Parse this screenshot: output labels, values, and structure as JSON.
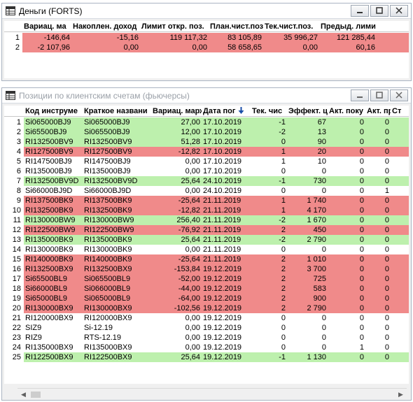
{
  "money_window": {
    "title": "Деньги (FORTS)",
    "columns": [
      "",
      "Вариац. ма",
      "Накоплен. доход",
      "Лимит откр. поз.",
      "План.чист.поз",
      "Тек.чист.поз.",
      "Предыд. лими"
    ],
    "rows": [
      {
        "n": "1",
        "cells": [
          "-146,64",
          "-15,16",
          "119 117,32",
          "83 105,89",
          "35 996,27",
          "121 285,44"
        ],
        "color": "red"
      },
      {
        "n": "2",
        "cells": [
          "-2 107,96",
          "0,00",
          "0,00",
          "58 658,65",
          "0,00",
          "60,16"
        ],
        "color": "red"
      }
    ]
  },
  "positions_window": {
    "title": "Позиции по клиентским счетам (фьючерсы)",
    "columns": [
      "",
      "Код инструме",
      "Краткое названи",
      "Вариац. марж",
      "Дата пог",
      "Тек. чис",
      "Эффект. ц",
      "Акт. поку",
      "Акт. пр",
      "Ст"
    ],
    "sort_icon": "sort-down-arrow",
    "rows": [
      {
        "n": "1",
        "code": "Si065000BJ9",
        "name": "Si065000BJ9",
        "var": "27,00",
        "date": "17.10.2019",
        "cur": "-1",
        "eff": "67",
        "buy": "0",
        "sell": "0",
        "color": "green"
      },
      {
        "n": "2",
        "code": "Si65500BJ9",
        "name": "Si065500BJ9",
        "var": "12,00",
        "date": "17.10.2019",
        "cur": "-2",
        "eff": "13",
        "buy": "0",
        "sell": "0",
        "color": "green"
      },
      {
        "n": "3",
        "code": "RI132500BV9",
        "name": "RI132500BV9",
        "var": "51,28",
        "date": "17.10.2019",
        "cur": "0",
        "eff": "90",
        "buy": "0",
        "sell": "0",
        "color": "green"
      },
      {
        "n": "4",
        "code": "RI127500BV9",
        "name": "RI127500BV9",
        "var": "-12,82",
        "date": "17.10.2019",
        "cur": "1",
        "eff": "20",
        "buy": "0",
        "sell": "0",
        "color": "red"
      },
      {
        "n": "5",
        "code": "RI147500BJ9",
        "name": "RI147500BJ9",
        "var": "0,00",
        "date": "17.10.2019",
        "cur": "1",
        "eff": "10",
        "buy": "0",
        "sell": "0",
        "color": "white"
      },
      {
        "n": "6",
        "code": "RI135000BJ9",
        "name": "RI135000BJ9",
        "var": "0,00",
        "date": "17.10.2019",
        "cur": "0",
        "eff": "0",
        "buy": "0",
        "sell": "0",
        "color": "white"
      },
      {
        "n": "7",
        "code": "RI132500BV9D",
        "name": "RI132500BV9D",
        "var": "25,64",
        "date": "24.10.2019",
        "cur": "-1",
        "eff": "730",
        "buy": "0",
        "sell": "0",
        "color": "green"
      },
      {
        "n": "8",
        "code": "Si66000BJ9D",
        "name": "Si66000BJ9D",
        "var": "0,00",
        "date": "24.10.2019",
        "cur": "0",
        "eff": "0",
        "buy": "0",
        "sell": "1",
        "color": "white"
      },
      {
        "n": "9",
        "code": "RI137500BK9",
        "name": "RI137500BK9",
        "var": "-25,64",
        "date": "21.11.2019",
        "cur": "1",
        "eff": "1 740",
        "buy": "0",
        "sell": "0",
        "color": "red"
      },
      {
        "n": "10",
        "code": "RI132500BK9",
        "name": "RI132500BK9",
        "var": "-12,82",
        "date": "21.11.2019",
        "cur": "1",
        "eff": "4 170",
        "buy": "0",
        "sell": "0",
        "color": "red"
      },
      {
        "n": "11",
        "code": "RI130000BW9",
        "name": "RI130000BW9",
        "var": "256,40",
        "date": "21.11.2019",
        "cur": "-2",
        "eff": "1 670",
        "buy": "0",
        "sell": "0",
        "color": "green"
      },
      {
        "n": "12",
        "code": "RI122500BW9",
        "name": "RI122500BW9",
        "var": "-76,92",
        "date": "21.11.2019",
        "cur": "2",
        "eff": "450",
        "buy": "0",
        "sell": "0",
        "color": "red"
      },
      {
        "n": "13",
        "code": "RI135000BK9",
        "name": "RI135000BK9",
        "var": "25,64",
        "date": "21.11.2019",
        "cur": "-2",
        "eff": "2 790",
        "buy": "0",
        "sell": "0",
        "color": "green"
      },
      {
        "n": "14",
        "code": "RI130000BK9",
        "name": "RI130000BK9",
        "var": "0,00",
        "date": "21.11.2019",
        "cur": "0",
        "eff": "0",
        "buy": "0",
        "sell": "0",
        "color": "white"
      },
      {
        "n": "15",
        "code": "RI140000BK9",
        "name": "RI140000BK9",
        "var": "-25,64",
        "date": "21.11.2019",
        "cur": "2",
        "eff": "1 010",
        "buy": "0",
        "sell": "0",
        "color": "red"
      },
      {
        "n": "16",
        "code": "RI132500BX9",
        "name": "RI132500BX9",
        "var": "-153,84",
        "date": "19.12.2019",
        "cur": "2",
        "eff": "3 700",
        "buy": "0",
        "sell": "0",
        "color": "red"
      },
      {
        "n": "17",
        "code": "Si65500BL9",
        "name": "Si065500BL9",
        "var": "-52,00",
        "date": "19.12.2019",
        "cur": "2",
        "eff": "725",
        "buy": "0",
        "sell": "0",
        "color": "red"
      },
      {
        "n": "18",
        "code": "Si66000BL9",
        "name": "Si066000BL9",
        "var": "-44,00",
        "date": "19.12.2019",
        "cur": "2",
        "eff": "583",
        "buy": "0",
        "sell": "0",
        "color": "red"
      },
      {
        "n": "19",
        "code": "Si65000BL9",
        "name": "Si065000BL9",
        "var": "-64,00",
        "date": "19.12.2019",
        "cur": "2",
        "eff": "900",
        "buy": "0",
        "sell": "0",
        "color": "red"
      },
      {
        "n": "20",
        "code": "RI130000BX9",
        "name": "RI130000BX9",
        "var": "-102,56",
        "date": "19.12.2019",
        "cur": "2",
        "eff": "2 790",
        "buy": "0",
        "sell": "0",
        "color": "red"
      },
      {
        "n": "21",
        "code": "RI120000BX9",
        "name": "RI120000BX9",
        "var": "0,00",
        "date": "19.12.2019",
        "cur": "0",
        "eff": "0",
        "buy": "0",
        "sell": "0",
        "color": "white"
      },
      {
        "n": "22",
        "code": "SIZ9",
        "name": "Si-12.19",
        "var": "0,00",
        "date": "19.12.2019",
        "cur": "0",
        "eff": "0",
        "buy": "0",
        "sell": "0",
        "color": "white"
      },
      {
        "n": "23",
        "code": "RIZ9",
        "name": "RTS-12.19",
        "var": "0,00",
        "date": "19.12.2019",
        "cur": "0",
        "eff": "0",
        "buy": "0",
        "sell": "0",
        "color": "white"
      },
      {
        "n": "24",
        "code": "RI135000BX9",
        "name": "RI135000BX9",
        "var": "0,00",
        "date": "19.12.2019",
        "cur": "0",
        "eff": "0",
        "buy": "1",
        "sell": "0",
        "color": "white"
      },
      {
        "n": "25",
        "code": "RI122500BX9",
        "name": "RI122500BX9",
        "var": "25,64",
        "date": "19.12.2019",
        "cur": "-1",
        "eff": "1 130",
        "buy": "0",
        "sell": "0",
        "color": "green"
      }
    ]
  },
  "colors": {
    "negative_row": "#f08a8a",
    "positive_row": "#bdf0ad"
  }
}
